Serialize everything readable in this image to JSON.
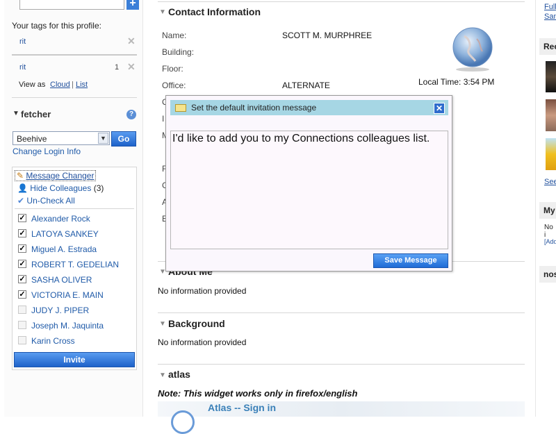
{
  "left": {
    "tags_heading": "Your tags for this profile:",
    "tags": [
      {
        "name": "rit",
        "count": ""
      },
      {
        "name": "rit",
        "count": "1"
      }
    ],
    "view_as": "View as",
    "view_cloud": "Cloud",
    "view_sep": "|",
    "view_list": "List",
    "fetcher_title": "fetcher",
    "help_glyph": "?",
    "service_selected": "Beehive",
    "go_label": "Go",
    "change_login": "Change Login Info",
    "message_changer": "Message Changer",
    "hide_colleagues": "Hide Colleagues",
    "hide_count": "(3)",
    "uncheck_all": "Un-Check All",
    "colleagues": [
      {
        "name": "Alexander Rock",
        "checked": true
      },
      {
        "name": "LATOYA SANKEY",
        "checked": true
      },
      {
        "name": "Miguel A. Estrada",
        "checked": true
      },
      {
        "name": "ROBERT T. GEDELIAN",
        "checked": true
      },
      {
        "name": "SASHA OLIVER",
        "checked": true
      },
      {
        "name": "VICTORIA E. MAIN",
        "checked": true
      },
      {
        "name": "JUDY J. PIPER",
        "checked": false
      },
      {
        "name": "Joseph M. Jaquinta",
        "checked": false
      },
      {
        "name": "Karin Cross",
        "checked": false
      }
    ],
    "invite_label": "Invite"
  },
  "main": {
    "contact_title": "Contact Information",
    "fields": {
      "name_label": "Name:",
      "name_value": "SCOTT M. MURPHREE",
      "building_label": "Building:",
      "floor_label": "Floor:",
      "office_label": "Office:",
      "office_value": "ALTERNATE"
    },
    "local_time": "Local Time: 3:54 PM",
    "about_title": "About Me",
    "about_text": "No information provided",
    "background_title": "Background",
    "background_text": "No information provided",
    "atlas_title": "atlas",
    "atlas_note": "Note: This widget works only in firefox/english",
    "atlas_signin": "Atlas -- Sign in"
  },
  "dialog": {
    "title": "Set the default invitation message",
    "message": "I'd like to add you to my Connections colleagues list.",
    "close_glyph": "✕",
    "save_label": "Save Message"
  },
  "right": {
    "link_full": "Full",
    "link_sam": "San",
    "recent_head": "Rec",
    "see_link": "See",
    "my_head": "My",
    "no_text": "No i",
    "add_link": "[Add",
    "nos_head": "nos"
  },
  "colors": {
    "accent_blue": "#1f5aa8",
    "dialog_title_bg": "#a6d6e4",
    "button_blue": "#1f6bd6"
  }
}
